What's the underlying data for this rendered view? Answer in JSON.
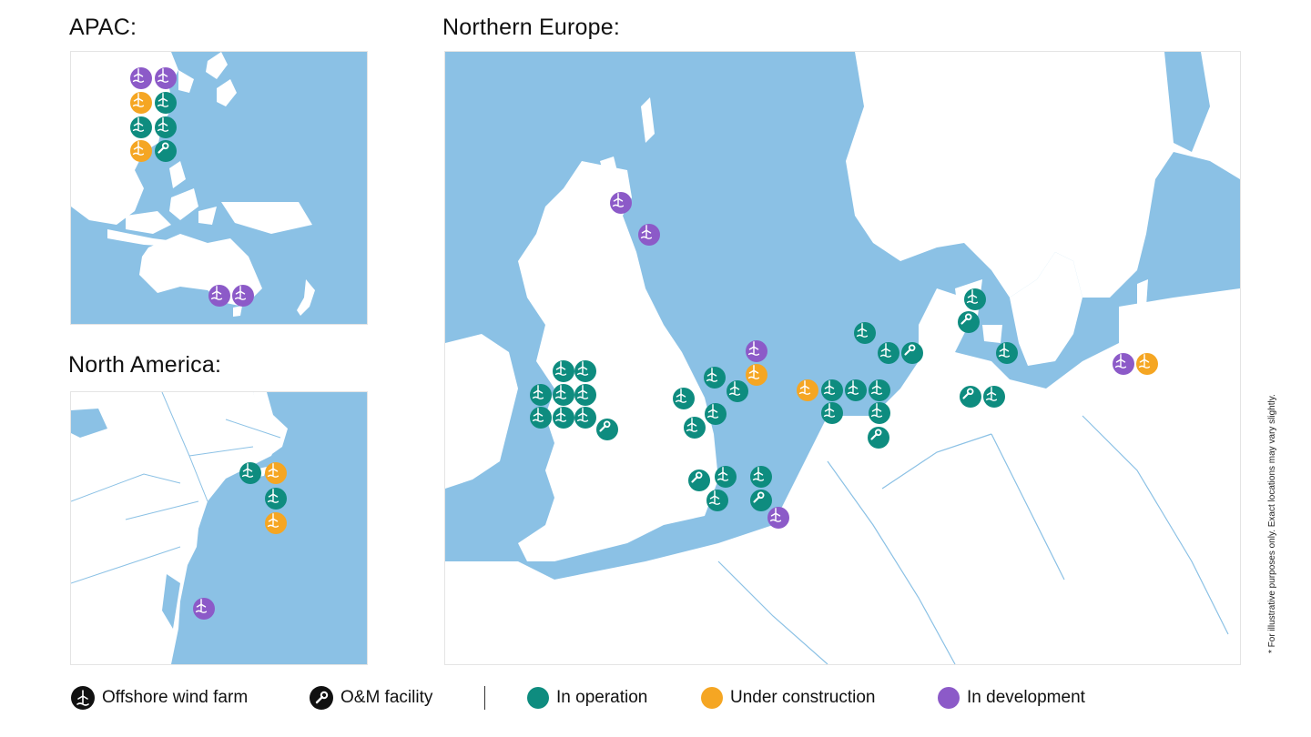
{
  "titles": {
    "apac": "APAC:",
    "north_america": "North America:",
    "northern_europe": "Northern Europe:"
  },
  "colors": {
    "in_operation": "#0e8c7f",
    "under_construction": "#f5a623",
    "in_development": "#8c5ac8",
    "water": "#8bc1e5",
    "land": "#ffffff"
  },
  "legend": {
    "wind_farm": "Offshore wind farm",
    "om_facility": "O&M facility",
    "in_operation": "In operation",
    "under_construction": "Under construction",
    "in_development": "In development"
  },
  "footnote": "*   For illustrative purposes only. Exact locations may vary slightly.",
  "markers": {
    "apac": [
      {
        "status": "in_development",
        "type": "wind_farm"
      },
      {
        "status": "in_development",
        "type": "wind_farm"
      },
      {
        "status": "under_construction",
        "type": "wind_farm"
      },
      {
        "status": "in_operation",
        "type": "wind_farm"
      },
      {
        "status": "in_operation",
        "type": "wind_farm"
      },
      {
        "status": "in_operation",
        "type": "wind_farm"
      },
      {
        "status": "under_construction",
        "type": "wind_farm"
      },
      {
        "status": "in_operation",
        "type": "om_facility"
      },
      {
        "status": "in_development",
        "type": "wind_farm"
      },
      {
        "status": "in_development",
        "type": "wind_farm"
      }
    ],
    "north_america": [
      {
        "status": "in_operation",
        "type": "wind_farm"
      },
      {
        "status": "under_construction",
        "type": "wind_farm"
      },
      {
        "status": "in_operation",
        "type": "wind_farm"
      },
      {
        "status": "under_construction",
        "type": "wind_farm"
      },
      {
        "status": "in_development",
        "type": "wind_farm"
      }
    ],
    "northern_europe": [
      {
        "status": "in_development",
        "type": "wind_farm"
      },
      {
        "status": "in_development",
        "type": "wind_farm"
      },
      {
        "status": "in_development",
        "type": "wind_farm"
      },
      {
        "status": "in_operation",
        "type": "wind_farm"
      },
      {
        "status": "in_operation",
        "type": "wind_farm"
      },
      {
        "status": "in_operation",
        "type": "wind_farm"
      },
      {
        "status": "in_operation",
        "type": "wind_farm"
      },
      {
        "status": "in_operation",
        "type": "wind_farm"
      },
      {
        "status": "in_operation",
        "type": "wind_farm"
      },
      {
        "status": "in_operation",
        "type": "wind_farm"
      },
      {
        "status": "in_operation",
        "type": "wind_farm"
      },
      {
        "status": "in_operation",
        "type": "om_facility"
      },
      {
        "status": "in_operation",
        "type": "wind_farm"
      },
      {
        "status": "in_operation",
        "type": "wind_farm"
      },
      {
        "status": "in_operation",
        "type": "wind_farm"
      },
      {
        "status": "in_operation",
        "type": "wind_farm"
      },
      {
        "status": "in_operation",
        "type": "wind_farm"
      },
      {
        "status": "in_operation",
        "type": "om_facility"
      },
      {
        "status": "in_operation",
        "type": "wind_farm"
      },
      {
        "status": "in_operation",
        "type": "wind_farm"
      },
      {
        "status": "in_operation",
        "type": "wind_farm"
      },
      {
        "status": "in_operation",
        "type": "om_facility"
      },
      {
        "status": "in_development",
        "type": "wind_farm"
      },
      {
        "status": "under_construction",
        "type": "wind_farm"
      },
      {
        "status": "under_construction",
        "type": "wind_farm"
      },
      {
        "status": "in_operation",
        "type": "wind_farm"
      },
      {
        "status": "in_operation",
        "type": "wind_farm"
      },
      {
        "status": "in_operation",
        "type": "wind_farm"
      },
      {
        "status": "in_operation",
        "type": "wind_farm"
      },
      {
        "status": "in_operation",
        "type": "wind_farm"
      },
      {
        "status": "in_operation",
        "type": "om_facility"
      },
      {
        "status": "in_operation",
        "type": "wind_farm"
      },
      {
        "status": "in_operation",
        "type": "wind_farm"
      },
      {
        "status": "in_operation",
        "type": "om_facility"
      },
      {
        "status": "in_operation",
        "type": "wind_farm"
      },
      {
        "status": "in_operation",
        "type": "om_facility"
      },
      {
        "status": "in_operation",
        "type": "wind_farm"
      },
      {
        "status": "in_operation",
        "type": "om_facility"
      },
      {
        "status": "in_operation",
        "type": "wind_farm"
      },
      {
        "status": "in_development",
        "type": "wind_farm"
      },
      {
        "status": "under_construction",
        "type": "wind_farm"
      }
    ]
  }
}
